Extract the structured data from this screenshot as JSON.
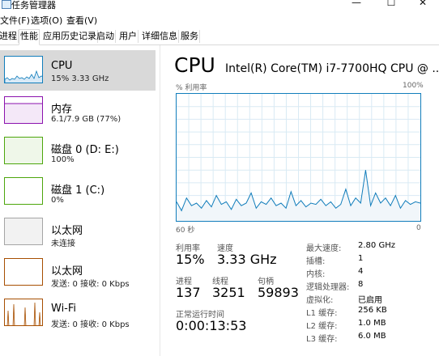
{
  "window": {
    "title": "任务管理器",
    "minimize_glyph": "—",
    "maximize_glyph": "☐",
    "close_glyph": "✕"
  },
  "menu": {
    "items": [
      "文件(F)",
      "选项(O)",
      "查看(V)"
    ]
  },
  "tabs": [
    "进程",
    "性能",
    "应用历史记录",
    "启动",
    "用户",
    "详细信息",
    "服务"
  ],
  "active_tab": "性能",
  "sidebar": {
    "items": [
      {
        "name": "CPU",
        "sub": "15%  3.33 GHz",
        "color": "#117dbb",
        "icon": "cpu-graph"
      },
      {
        "name": "内存",
        "sub": "6.1/7.9 GB (77%)",
        "color": "#8b12ae",
        "icon": "memory-graph"
      },
      {
        "name": "磁盘 0 (D: E:)",
        "sub": "100%",
        "color": "#4da60c",
        "icon": "disk-graph"
      },
      {
        "name": "磁盘 1 (C:)",
        "sub": "0%",
        "color": "#4da60c",
        "icon": "disk-graph"
      },
      {
        "name": "以太网",
        "sub": "未连接",
        "color": "#a5a5a5",
        "icon": "ethernet-graph"
      },
      {
        "name": "以太网",
        "sub": "发送: 0 接收: 0 Kbps",
        "color": "#a74f01",
        "icon": "ethernet-graph"
      },
      {
        "name": "Wi-Fi",
        "sub": "发送: 0 接收: 0 Kbps",
        "color": "#a74f01",
        "icon": "wifi-graph"
      }
    ]
  },
  "main": {
    "title": "CPU",
    "model": "Intel(R) Core(TM) i7-7700HQ CPU @ ...",
    "util_label": "% 利用率",
    "util_max": "100%",
    "time_label": "60 秒",
    "time_zero": "0",
    "stats": {
      "util_label": "利用率",
      "util_value": "15%",
      "speed_label": "速度",
      "speed_value": "3.33 GHz",
      "proc_label": "进程",
      "proc_value": "137",
      "thread_label": "线程",
      "thread_value": "3251",
      "handle_label": "句柄",
      "handle_value": "59893",
      "uptime_label": "正常运行时间",
      "uptime_value": "0:00:13:53"
    },
    "specs": [
      {
        "label": "最大速度:",
        "value": "2.80 GHz"
      },
      {
        "label": "插槽:",
        "value": "1"
      },
      {
        "label": "内核:",
        "value": "4"
      },
      {
        "label": "逻辑处理器:",
        "value": "8"
      },
      {
        "label": "虚拟化:",
        "value": "已启用"
      },
      {
        "label": "L1 缓存:",
        "value": "256 KB"
      },
      {
        "label": "L2 缓存:",
        "value": "1.0 MB"
      },
      {
        "label": "L3 缓存:",
        "value": "6.0 MB"
      }
    ]
  },
  "cpu_history_percent": [
    15,
    8,
    18,
    12,
    14,
    10,
    16,
    11,
    20,
    13,
    15,
    9,
    17,
    12,
    14,
    22,
    10,
    15,
    13,
    18,
    12,
    14,
    10,
    23,
    12,
    16,
    11,
    14,
    13,
    17,
    12,
    15,
    10,
    13,
    25,
    12,
    18,
    14,
    40,
    12,
    22,
    14,
    18,
    12,
    20,
    10,
    16,
    13,
    15,
    14
  ]
}
